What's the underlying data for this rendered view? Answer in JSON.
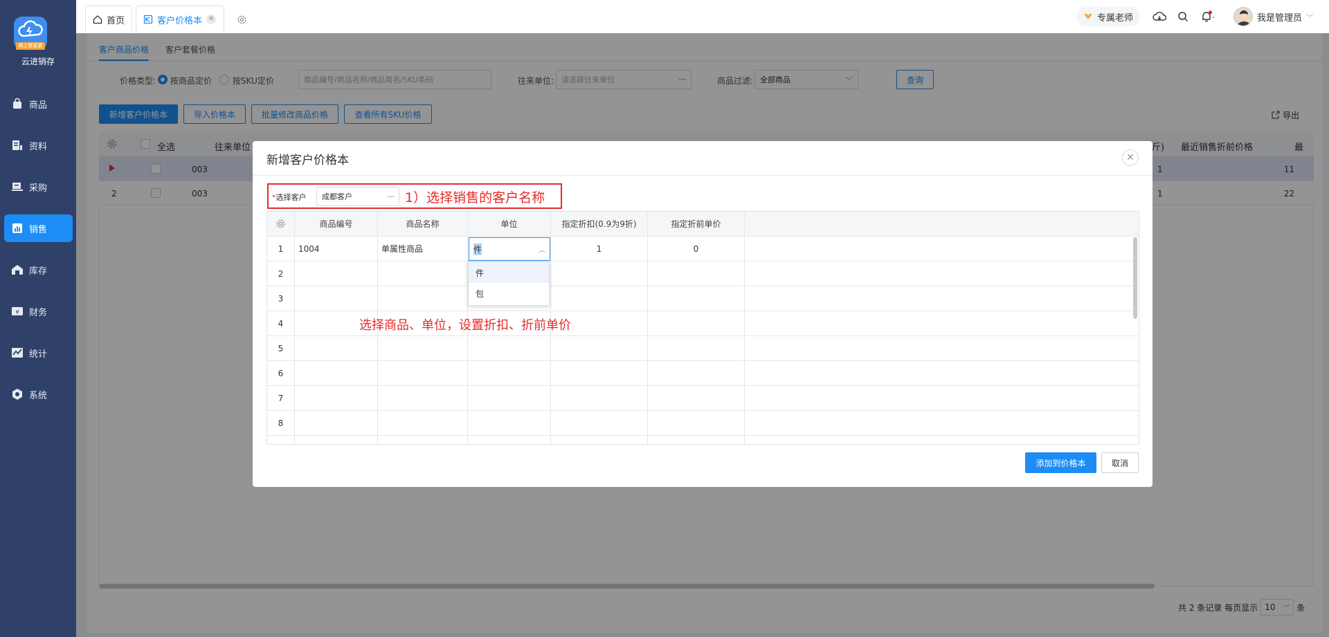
{
  "app": {
    "name": "云进销存",
    "logo_caption": "网上管家婆"
  },
  "sidebar": {
    "items": [
      {
        "label": "商品",
        "icon": "bag-icon"
      },
      {
        "label": "资料",
        "icon": "document-icon"
      },
      {
        "label": "采购",
        "icon": "cart-icon"
      },
      {
        "label": "销售",
        "icon": "chart-icon",
        "active": true
      },
      {
        "label": "库存",
        "icon": "warehouse-icon"
      },
      {
        "label": "财务",
        "icon": "finance-icon"
      },
      {
        "label": "统计",
        "icon": "stats-icon"
      },
      {
        "label": "系统",
        "icon": "settings-icon"
      }
    ]
  },
  "tabs": {
    "home": "首页",
    "active": "客户价格本"
  },
  "topright": {
    "teacher": "专属老师",
    "user": "我是管理员"
  },
  "subtabs": {
    "item1": "客户商品价格",
    "item2": "客户套餐价格"
  },
  "filters": {
    "price_type_label": "价格类型:",
    "radio1": "按商品定价",
    "radio2": "按SKU定价",
    "search_placeholder": "商品编号/商品名称/商品简名/SKU条码",
    "partner_label": "往来单位:",
    "partner_placeholder": "请选择往来单位",
    "filter_label": "商品过滤:",
    "filter_value": "全部商品",
    "query": "查询"
  },
  "toolbar": {
    "add": "新增客户价格本",
    "import": "导入价格本",
    "batch": "批量修改商品价格",
    "view_sku": "查看所有SKU价格",
    "export": "导出"
  },
  "bgtable": {
    "select_all": "全选",
    "col_partner": "往来单位",
    "col_right1": "最近销售折前价格",
    "col_right2": "最",
    "col_frag": "斤)",
    "rows": [
      {
        "no": "",
        "code": "003",
        "c1": "1",
        "price": "11"
      },
      {
        "no": "2",
        "code": "003",
        "c1": "1",
        "price": "22"
      }
    ]
  },
  "footer": {
    "total": "共 2 条记录",
    "per_page": "每页显示",
    "page_size": "10",
    "unit": "条"
  },
  "modal": {
    "title": "新增客户价格本",
    "customer_label": "选择客户",
    "customer_value": "成都客户",
    "annotation1": "1）选择销售的客户名称",
    "annotation2": "选择商品、单位，设置折扣、折前单价",
    "columns": [
      "商品编号",
      "商品名称",
      "单位",
      "指定折扣(0.9为9折)",
      "指定折前单价"
    ],
    "rows": [
      {
        "no": "1",
        "code": "1004",
        "name": "单属性商品",
        "unit": "件",
        "discount": "1",
        "price": "0"
      },
      {
        "no": "2"
      },
      {
        "no": "3"
      },
      {
        "no": "4"
      },
      {
        "no": "5"
      },
      {
        "no": "6"
      },
      {
        "no": "7"
      },
      {
        "no": "8"
      }
    ],
    "unit_options": [
      "件",
      "包"
    ],
    "add_button": "添加到价格本",
    "cancel_button": "取消"
  },
  "colors": {
    "accent": "#1e8cf5",
    "sidebar": "#2f4168",
    "annotation": "#e52a2a"
  }
}
